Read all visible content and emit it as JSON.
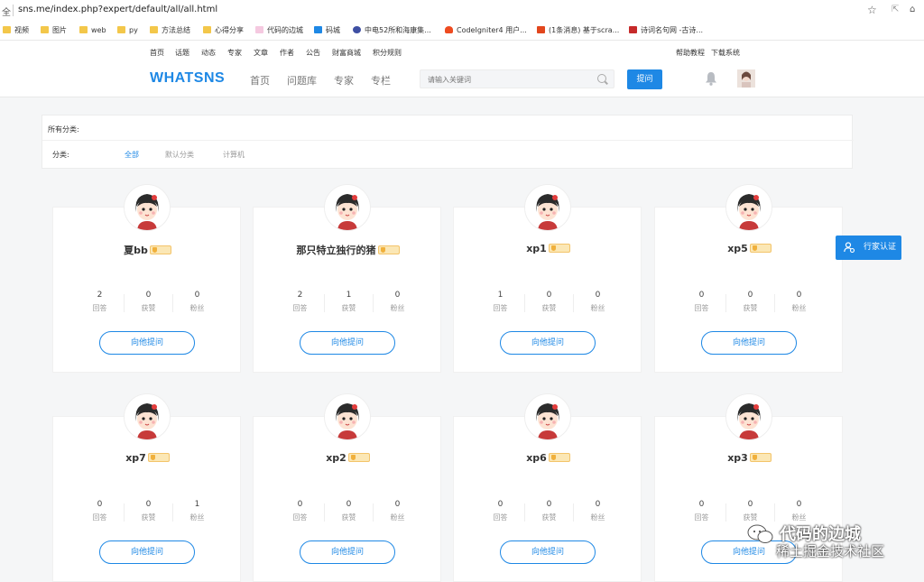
{
  "browser": {
    "secure_label": "全",
    "url": "sns.me/index.php?expert/default/all/all.html",
    "bookmarks": [
      "视频",
      "图片",
      "web",
      "py",
      "方法总结",
      "心得分享",
      "代码的边城",
      "码城",
      "中电52所和海康集...",
      "CodeIgniter4 用户...",
      "(1条消息) 基于scra...",
      "诗词名句网 -古诗..."
    ]
  },
  "topnav": {
    "links": [
      "首页",
      "话题",
      "动态",
      "专家",
      "文章",
      "作者",
      "公告",
      "财富商城",
      "积分规则"
    ],
    "right_links": [
      "帮助教程",
      "下载系统"
    ]
  },
  "header": {
    "logo": "WHATSNS",
    "nav": [
      "首页",
      "问题库",
      "专家",
      "专栏"
    ],
    "search_placeholder": "请输入关键词",
    "ask_button": "提问"
  },
  "categories": {
    "all_label": "所有分类:",
    "filter_label": "分类:",
    "items": [
      "全部",
      "默认分类",
      "计算机"
    ],
    "active": "全部"
  },
  "stat_labels": [
    "回答",
    "获赞",
    "粉丝"
  ],
  "ask_him_label": "向他提问",
  "experts": [
    {
      "name": "夏bb",
      "stats": [
        "2",
        "0",
        "0"
      ]
    },
    {
      "name": "那只特立独行的猪",
      "stats": [
        "2",
        "1",
        "0"
      ]
    },
    {
      "name": "xp1",
      "stats": [
        "1",
        "0",
        "0"
      ]
    },
    {
      "name": "xp5",
      "stats": [
        "0",
        "0",
        "0"
      ]
    },
    {
      "name": "xp7",
      "stats": [
        "0",
        "0",
        "1"
      ]
    },
    {
      "name": "xp2",
      "stats": [
        "0",
        "0",
        "0"
      ]
    },
    {
      "name": "xp6",
      "stats": [
        "0",
        "0",
        "0"
      ]
    },
    {
      "name": "xp3",
      "stats": [
        "0",
        "0",
        "0"
      ]
    }
  ],
  "certify_button": "行家认证",
  "watermark": {
    "line1": "代码的边城",
    "line2": "稀土掘金技术社区"
  },
  "colors": {
    "accent": "#1e88e5",
    "badge": "#f3c46a"
  }
}
